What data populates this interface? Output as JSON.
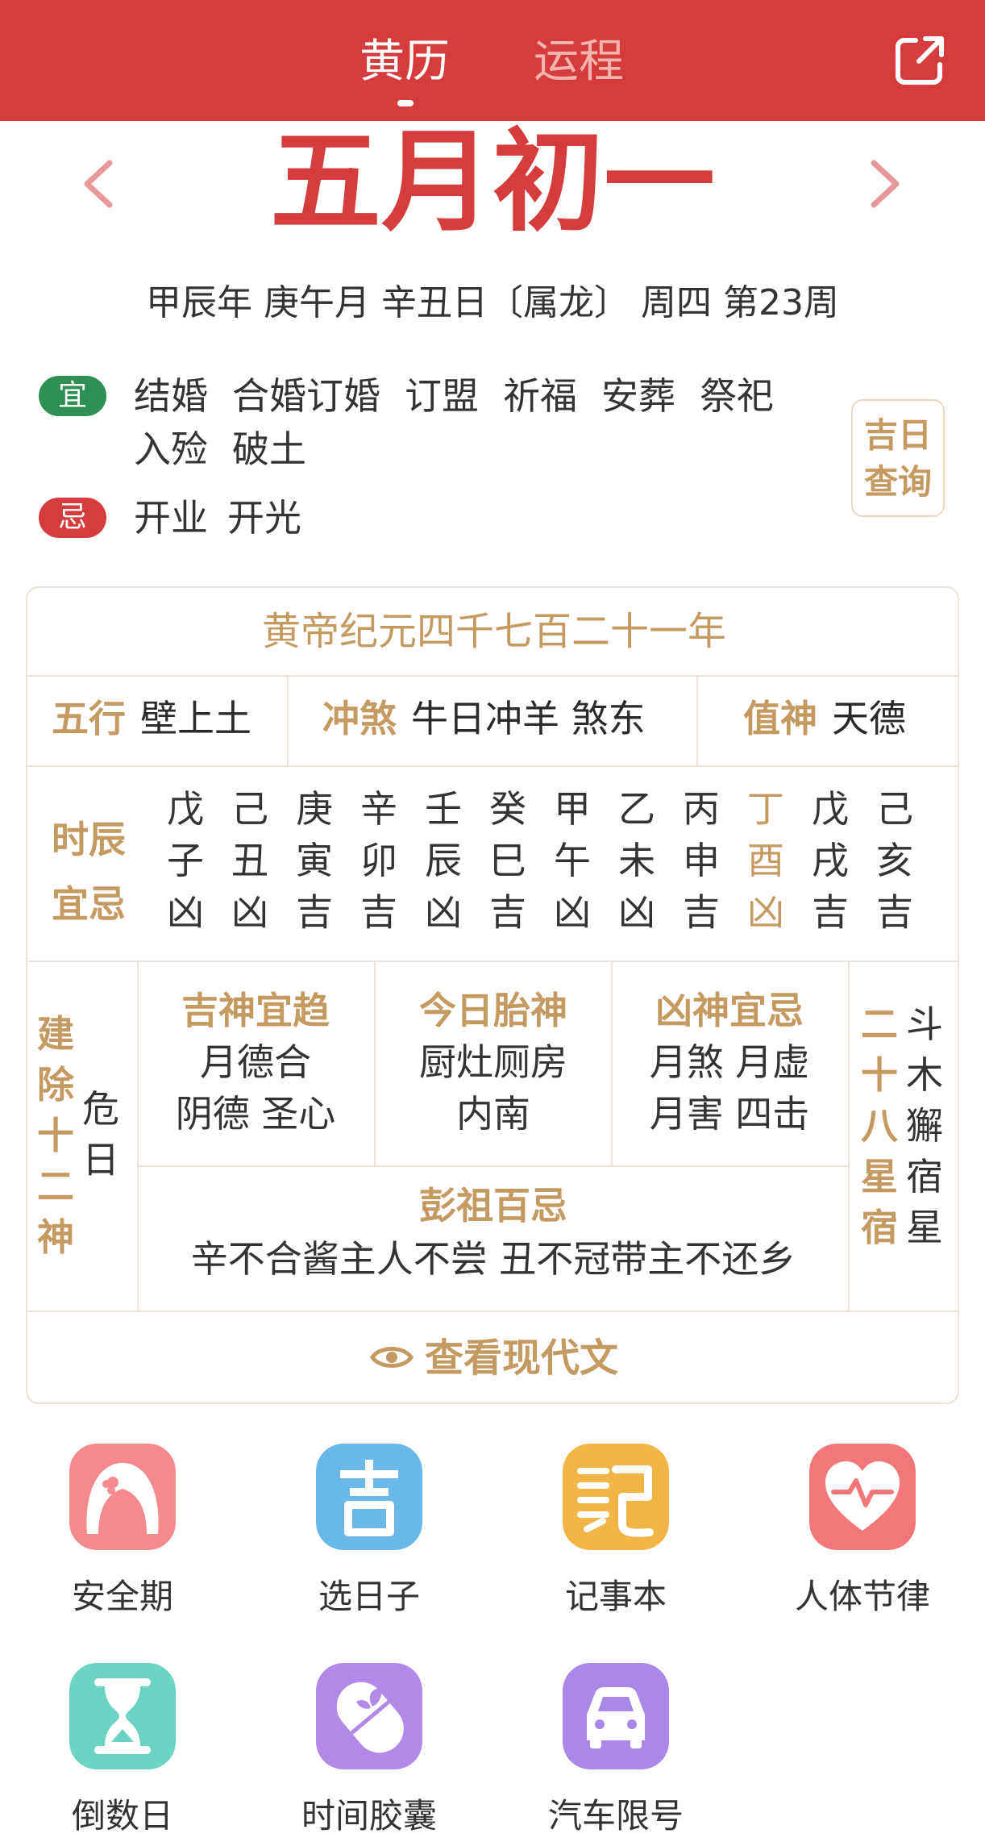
{
  "header": {
    "tabs": [
      {
        "label": "黄历",
        "active": true
      },
      {
        "label": "运程",
        "active": false
      }
    ],
    "share_icon": "external-link-icon",
    "color": "#d53c3d"
  },
  "date": {
    "lunar": "五月初一",
    "ganzhi": "甲辰年 庚午月 辛丑日〔属龙〕 周四  第23周"
  },
  "yi": {
    "badge": "宜",
    "items": [
      "结婚",
      "合婚订婚",
      "订盟",
      "祈福",
      "安葬",
      "祭祀",
      "入殓",
      "破土"
    ]
  },
  "ji": {
    "badge": "忌",
    "items": [
      "开业",
      "开光"
    ]
  },
  "query_button": {
    "line1": "吉日",
    "line2": "查询"
  },
  "almanac": {
    "era": "黄帝纪元四千七百二十一年",
    "wuxing": {
      "label": "五行",
      "value": "壁上土"
    },
    "chongsha": {
      "label": "冲煞",
      "value": "牛日冲羊 煞东"
    },
    "zhishen": {
      "label": "值神",
      "value": "天德"
    },
    "hours_label": [
      "时辰",
      "宜忌"
    ],
    "hours": [
      {
        "stem": "戊",
        "branch": "子",
        "luck": "凶"
      },
      {
        "stem": "己",
        "branch": "丑",
        "luck": "凶"
      },
      {
        "stem": "庚",
        "branch": "寅",
        "luck": "吉"
      },
      {
        "stem": "辛",
        "branch": "卯",
        "luck": "吉"
      },
      {
        "stem": "壬",
        "branch": "辰",
        "luck": "凶"
      },
      {
        "stem": "癸",
        "branch": "巳",
        "luck": "吉"
      },
      {
        "stem": "甲",
        "branch": "午",
        "luck": "凶"
      },
      {
        "stem": "乙",
        "branch": "未",
        "luck": "凶"
      },
      {
        "stem": "丙",
        "branch": "申",
        "luck": "吉"
      },
      {
        "stem": "丁",
        "branch": "酉",
        "luck": "凶",
        "current": true
      },
      {
        "stem": "戊",
        "branch": "戌",
        "luck": "吉"
      },
      {
        "stem": "己",
        "branch": "亥",
        "luck": "吉"
      }
    ],
    "jianchu": {
      "label": [
        "建",
        "除",
        "十",
        "二",
        "神"
      ],
      "value": [
        "危",
        "日"
      ]
    },
    "jishen": {
      "title": "吉神宜趋",
      "lines": [
        "月德合",
        "阴德 圣心"
      ]
    },
    "taishen": {
      "title": "今日胎神",
      "lines": [
        "厨灶厕房",
        "内南"
      ]
    },
    "xiongshen": {
      "title": "凶神宜忌",
      "lines": [
        "月煞 月虚",
        "月害 四击"
      ]
    },
    "xiu": {
      "label": [
        "二",
        "十",
        "八",
        "星",
        "宿"
      ],
      "value": [
        "斗",
        "木",
        "獬",
        "宿",
        "星"
      ]
    },
    "pengzu": {
      "title": "彭祖百忌",
      "text": "辛不合酱主人不尝 丑不冠带主不还乡"
    },
    "view_modern": "查看现代文"
  },
  "tools": [
    {
      "label": "安全期",
      "icon": "girl-face-icon",
      "color": "#f48a8f"
    },
    {
      "label": "选日子",
      "icon": "ji-character-icon",
      "color": "#69b8ea"
    },
    {
      "label": "记事本",
      "icon": "ji-note-icon",
      "color": "#f2b545"
    },
    {
      "label": "人体节律",
      "icon": "heart-pulse-icon",
      "color": "#f2777b"
    },
    {
      "label": "倒数日",
      "icon": "hourglass-icon",
      "color": "#6ad3c2"
    },
    {
      "label": "时间胶囊",
      "icon": "capsule-icon",
      "color": "#b289e8"
    },
    {
      "label": "汽车限号",
      "icon": "car-icon",
      "color": "#a987e6"
    }
  ]
}
